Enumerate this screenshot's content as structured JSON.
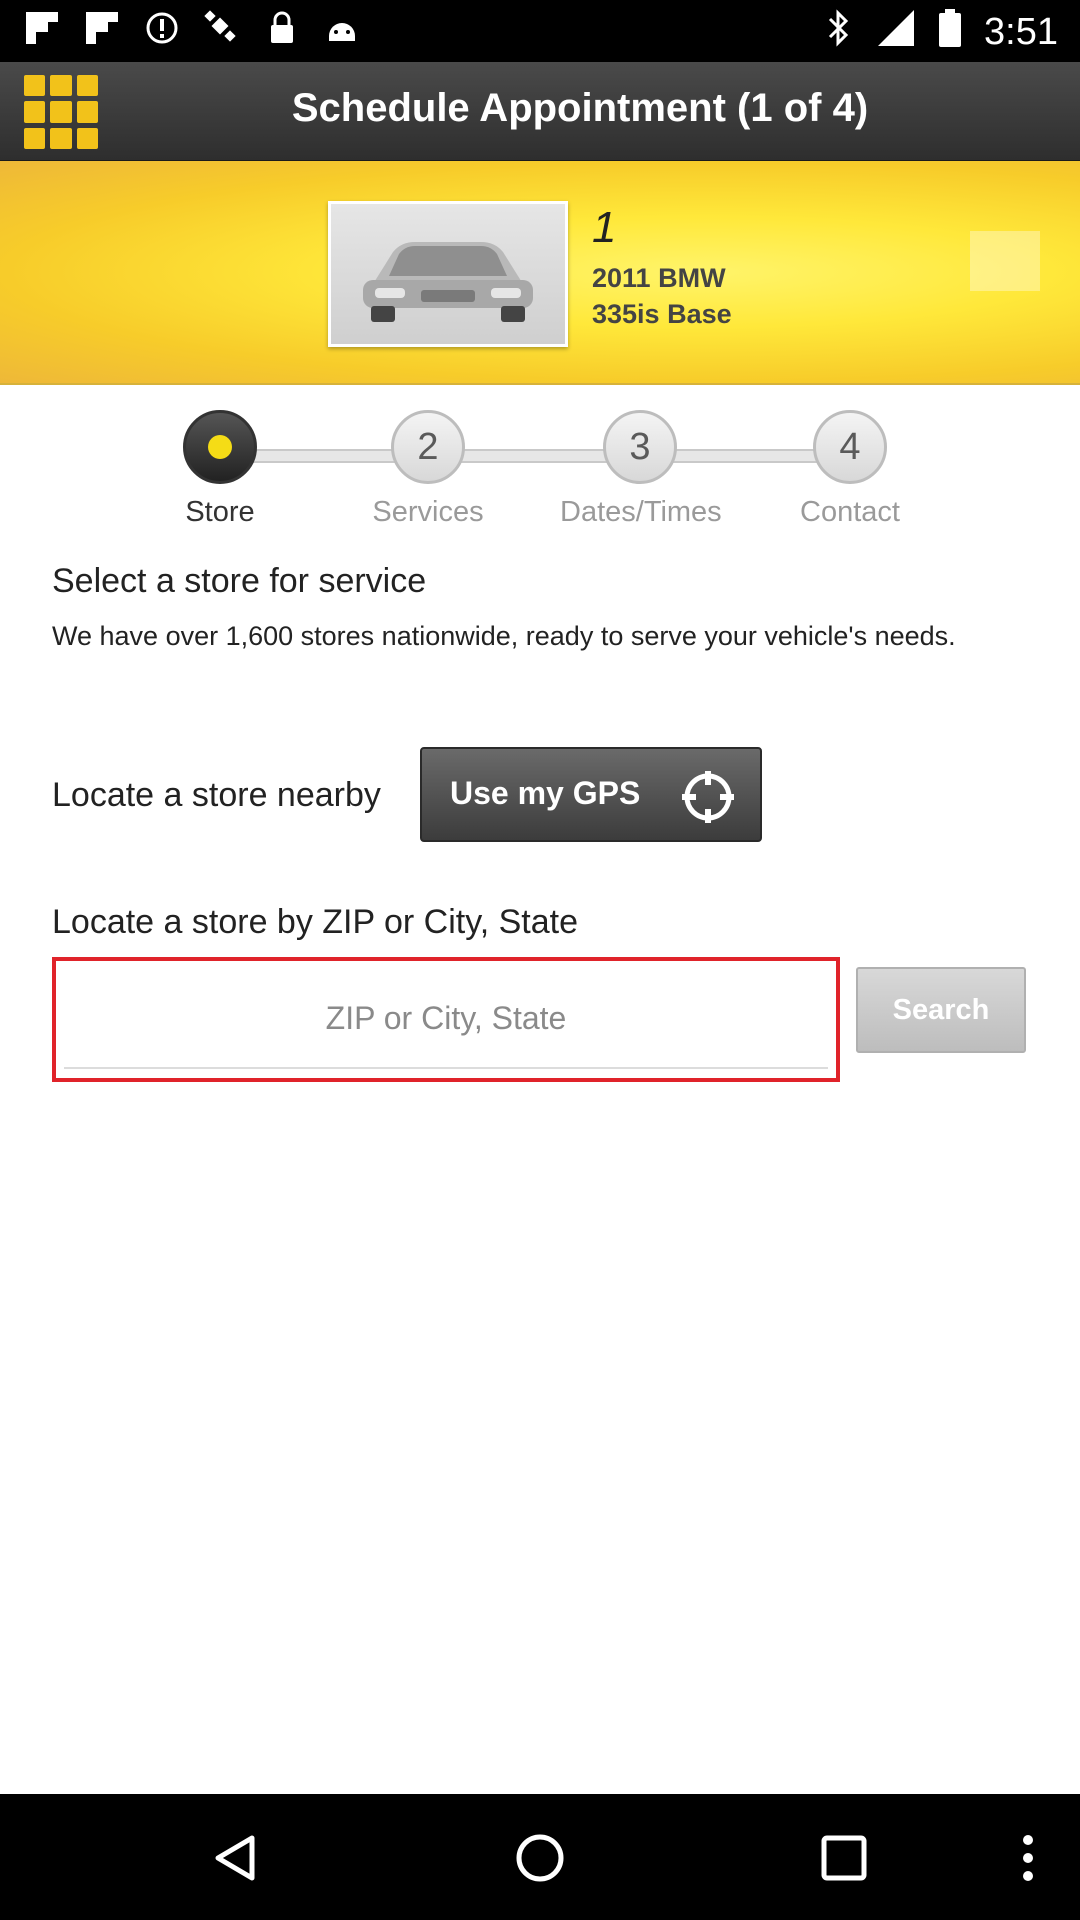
{
  "status_bar": {
    "time": "3:51",
    "left_icons": [
      "flipboard-icon",
      "flipboard-icon",
      "alert-circle-icon",
      "satellite-icon",
      "lock-icon",
      "android-icon"
    ],
    "right_icons": [
      "bluetooth-icon",
      "signal-icon",
      "battery-icon"
    ]
  },
  "header": {
    "title": "Schedule Appointment (1 of 4)",
    "menu_icon": "grid-menu-icon"
  },
  "vehicle": {
    "number": "1",
    "year_make": "2011 BMW",
    "model": "335is Base",
    "thumbnail_icon": "car-icon"
  },
  "steps": [
    {
      "number": "",
      "label": "Store",
      "active": true
    },
    {
      "number": "2",
      "label": "Services",
      "active": false
    },
    {
      "number": "3",
      "label": "Dates/Times",
      "active": false
    },
    {
      "number": "4",
      "label": "Contact",
      "active": false
    }
  ],
  "content": {
    "heading": "Select a store for service",
    "description": "We have over 1,600 stores nationwide, ready to serve your vehicle's needs.",
    "nearby_label": "Locate a store nearby",
    "gps_button_label": "Use my GPS",
    "zip_label": "Locate a store by ZIP or City, State",
    "zip_placeholder": "ZIP or City, State",
    "zip_value": "",
    "search_button_label": "Search"
  },
  "colors": {
    "accent_yellow": "#f2c21a",
    "input_border_red": "#e0232a",
    "title_bar": "#3a3a3a"
  },
  "nav_bar": {
    "icons": [
      "back-icon",
      "home-icon",
      "recents-icon",
      "overflow-menu-icon"
    ]
  }
}
